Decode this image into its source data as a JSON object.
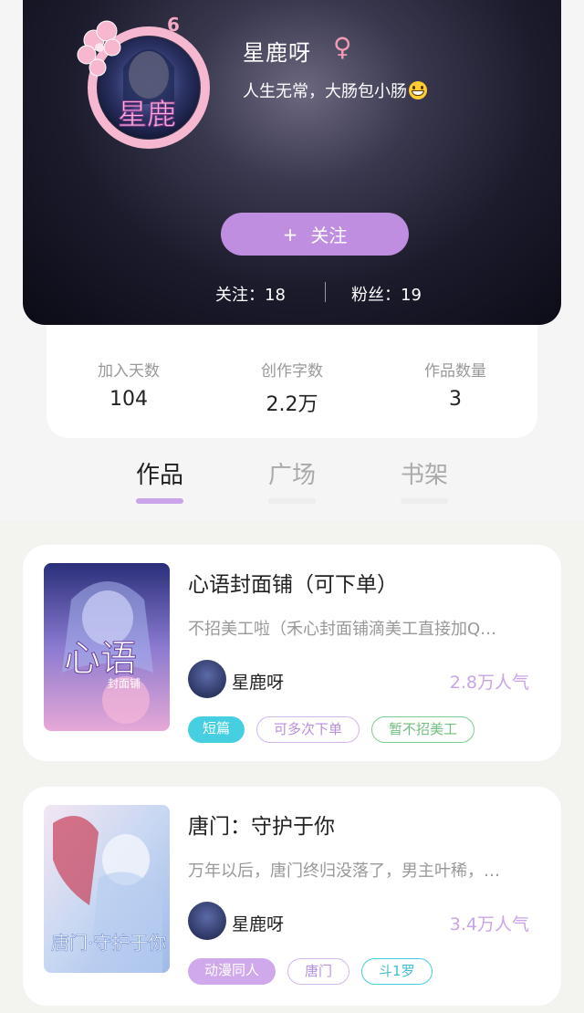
{
  "profile": {
    "username": "星鹿呀",
    "gender_symbol": "♀",
    "bio": "人生无常，大肠包小肠",
    "level_badge": "6",
    "avatar_text": "星鹿",
    "follow_button": {
      "plus": "+",
      "label": "关注"
    },
    "following": "关注：18",
    "fans": "粉丝：19"
  },
  "stats": [
    {
      "label": "加入天数",
      "value": "104"
    },
    {
      "label": "创作字数",
      "value": "2.2万"
    },
    {
      "label": "作品数量",
      "value": "3"
    }
  ],
  "tabs": [
    {
      "label": "作品",
      "active": true
    },
    {
      "label": "广场",
      "active": false
    },
    {
      "label": "书架",
      "active": false
    }
  ],
  "works": [
    {
      "title": "心语封面铺（可下单）",
      "description": "不招美工啦（禾心封面铺滴美工直接加Q…",
      "author": "星鹿呀",
      "popularity": "2.8万人气",
      "cover_text": "心语",
      "cover_subtext": "封面铺",
      "tags": [
        {
          "label": "短篇",
          "style": "filled-cyan"
        },
        {
          "label": "可多次下单",
          "style": "outline-purple"
        },
        {
          "label": "暂不招美工",
          "style": "outline-green"
        }
      ]
    },
    {
      "title": "唐门：守护于你",
      "description": "万年以后，唐门终归没落了，男主叶稀，…",
      "author": "星鹿呀",
      "popularity": "3.4万人气",
      "cover_text": "唐门·守护于你",
      "cover_subtext": "",
      "tags": [
        {
          "label": "动漫同人",
          "style": "filled-purple"
        },
        {
          "label": "唐门",
          "style": "outline-purple"
        },
        {
          "label": "斗1罗",
          "style": "outline-cyan"
        }
      ]
    }
  ],
  "colors": {
    "accent_purple": "#c08ee0",
    "popularity_purple": "#c9a4e8",
    "tag_cyan": "#45cfe0",
    "tag_green": "#7ccc8b"
  }
}
